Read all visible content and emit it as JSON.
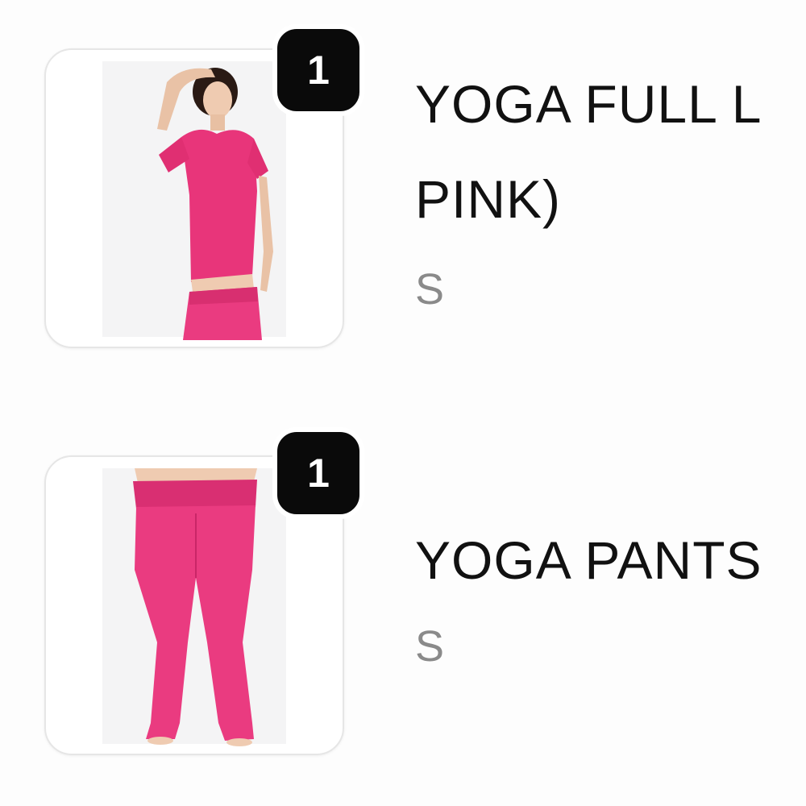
{
  "cart": {
    "items": [
      {
        "quantity": "1",
        "name_line1": "YOGA FULL L",
        "name_line2": "PINK)",
        "variant": "S",
        "image_icon": "pink-top-and-pants-photo",
        "accent_color": "#e8357a"
      },
      {
        "quantity": "1",
        "name_line1": "YOGA PANTS",
        "variant": "S",
        "image_icon": "pink-yoga-pants-photo",
        "accent_color": "#e8357a"
      }
    ]
  }
}
